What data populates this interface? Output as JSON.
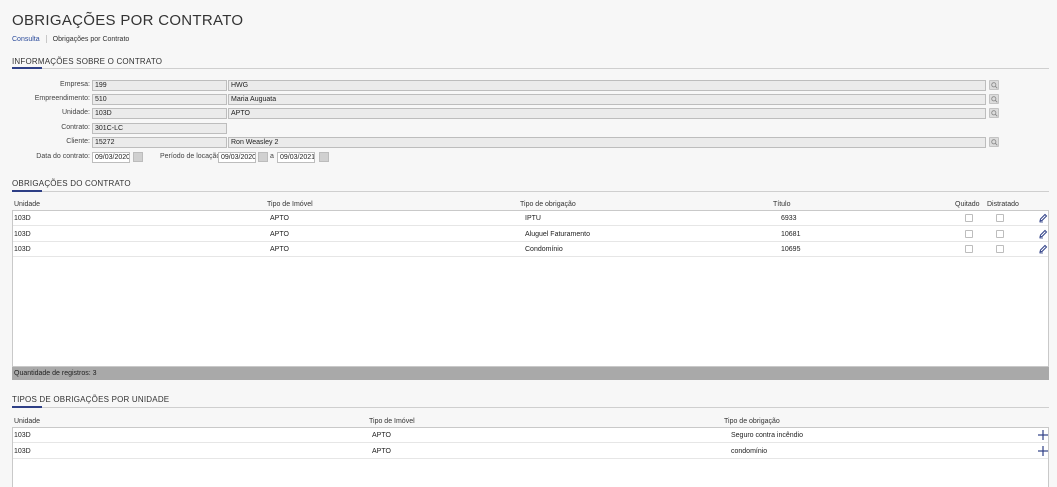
{
  "page": {
    "title": "OBRIGAÇÕES POR CONTRATO",
    "breadcrumb": {
      "link": "Consulta",
      "current": "Obrigações por Contrato"
    }
  },
  "info": {
    "title": "INFORMAÇÕES SOBRE O CONTRATO",
    "empresa": {
      "label": "Empresa:",
      "code": "199",
      "name": "HWG"
    },
    "empreendimento": {
      "label": "Empreendimento:",
      "code": "510",
      "name": "Maria Auguata"
    },
    "unidade": {
      "label": "Unidade:",
      "code": "103D",
      "name": "APTO"
    },
    "contrato": {
      "label": "Contrato:",
      "code": "301C-LC"
    },
    "cliente": {
      "label": "Cliente:",
      "code": "15272",
      "name": "Ron Weasley 2"
    },
    "data_contrato": {
      "label": "Data do contrato:",
      "value": "09/03/2020"
    },
    "periodo": {
      "label": "Período de locação:",
      "start": "09/03/2020",
      "sep": "a",
      "end": "09/03/2021"
    }
  },
  "obrigacoes": {
    "title": "OBRIGAÇÕES DO CONTRATO",
    "headers": {
      "unidade": "Unidade",
      "tipo_imovel": "Tipo de Imóvel",
      "tipo_obrigacao": "Tipo de obrigação",
      "titulo": "Título",
      "quitado": "Quitado",
      "distratado": "Distratado"
    },
    "rows": [
      {
        "unidade": "103D",
        "tipo_imovel": "APTO",
        "tipo_obrigacao": "IPTU",
        "titulo": "6933"
      },
      {
        "unidade": "103D",
        "tipo_imovel": "APTO",
        "tipo_obrigacao": "Aluguel Faturamento",
        "titulo": "10681"
      },
      {
        "unidade": "103D",
        "tipo_imovel": "APTO",
        "tipo_obrigacao": "Condomínio",
        "titulo": "10695"
      }
    ],
    "footer": "Quantidade de registros: 3"
  },
  "tipos": {
    "title": "TIPOS DE OBRIGAÇÕES POR UNIDADE",
    "headers": {
      "unidade": "Unidade",
      "tipo_imovel": "Tipo de Imóvel",
      "tipo_obrigacao": "Tipo de obrigação"
    },
    "rows": [
      {
        "unidade": "103D",
        "tipo_imovel": "APTO",
        "tipo_obrigacao": "Seguro contra incêndio"
      },
      {
        "unidade": "103D",
        "tipo_imovel": "APTO",
        "tipo_obrigacao": "condomínio"
      }
    ]
  },
  "icons": {
    "lookup": "search-icon",
    "calendar": "calendar-icon",
    "edit": "pencil-icon",
    "add": "plus-icon"
  },
  "colors": {
    "accent": "#2e3f86",
    "link": "#2b4b9b",
    "footer_bar": "#a9a9a9"
  }
}
